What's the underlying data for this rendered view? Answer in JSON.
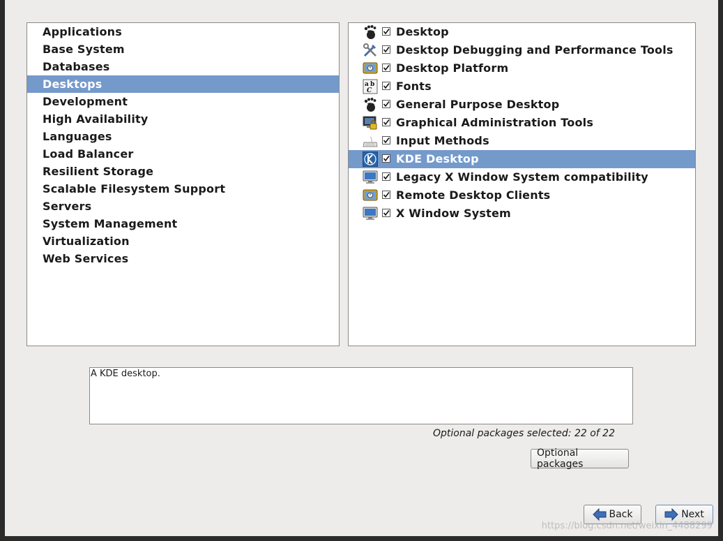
{
  "categories": [
    {
      "label": "Applications",
      "selected": false
    },
    {
      "label": "Base System",
      "selected": false
    },
    {
      "label": "Databases",
      "selected": false
    },
    {
      "label": "Desktops",
      "selected": true
    },
    {
      "label": "Development",
      "selected": false
    },
    {
      "label": "High Availability",
      "selected": false
    },
    {
      "label": "Languages",
      "selected": false
    },
    {
      "label": "Load Balancer",
      "selected": false
    },
    {
      "label": "Resilient Storage",
      "selected": false
    },
    {
      "label": "Scalable Filesystem Support",
      "selected": false
    },
    {
      "label": "Servers",
      "selected": false
    },
    {
      "label": "System Management",
      "selected": false
    },
    {
      "label": "Virtualization",
      "selected": false
    },
    {
      "label": "Web Services",
      "selected": false
    }
  ],
  "groups": [
    {
      "label": "Desktop",
      "icon": "gnome-foot-icon",
      "checked": true,
      "selected": false
    },
    {
      "label": "Desktop Debugging and Performance Tools",
      "icon": "tools-icon",
      "checked": true,
      "selected": false
    },
    {
      "label": "Desktop Platform",
      "icon": "desktop-platform-icon",
      "checked": true,
      "selected": false
    },
    {
      "label": "Fonts",
      "icon": "fonts-icon",
      "checked": true,
      "selected": false
    },
    {
      "label": "General Purpose Desktop",
      "icon": "gnome-foot-icon",
      "checked": true,
      "selected": false
    },
    {
      "label": "Graphical Administration Tools",
      "icon": "admin-lock-icon",
      "checked": true,
      "selected": false
    },
    {
      "label": "Input Methods",
      "icon": "keyboard-icon",
      "checked": true,
      "selected": false
    },
    {
      "label": "KDE Desktop",
      "icon": "kde-icon",
      "checked": true,
      "selected": true
    },
    {
      "label": "Legacy X Window System compatibility",
      "icon": "monitor-icon",
      "checked": true,
      "selected": false
    },
    {
      "label": "Remote Desktop Clients",
      "icon": "desktop-platform-icon",
      "checked": true,
      "selected": false
    },
    {
      "label": "X Window System",
      "icon": "monitor-icon",
      "checked": true,
      "selected": false
    }
  ],
  "description": "A KDE desktop.",
  "optional_status": "Optional packages selected: 22 of 22",
  "buttons": {
    "optional_packages": "Optional packages",
    "back": "Back",
    "next": "Next"
  },
  "watermark": "https://blog.csdn.net/weixin_4488299",
  "colors": {
    "selection": "#7499cb",
    "window_bg": "#edeceb"
  }
}
